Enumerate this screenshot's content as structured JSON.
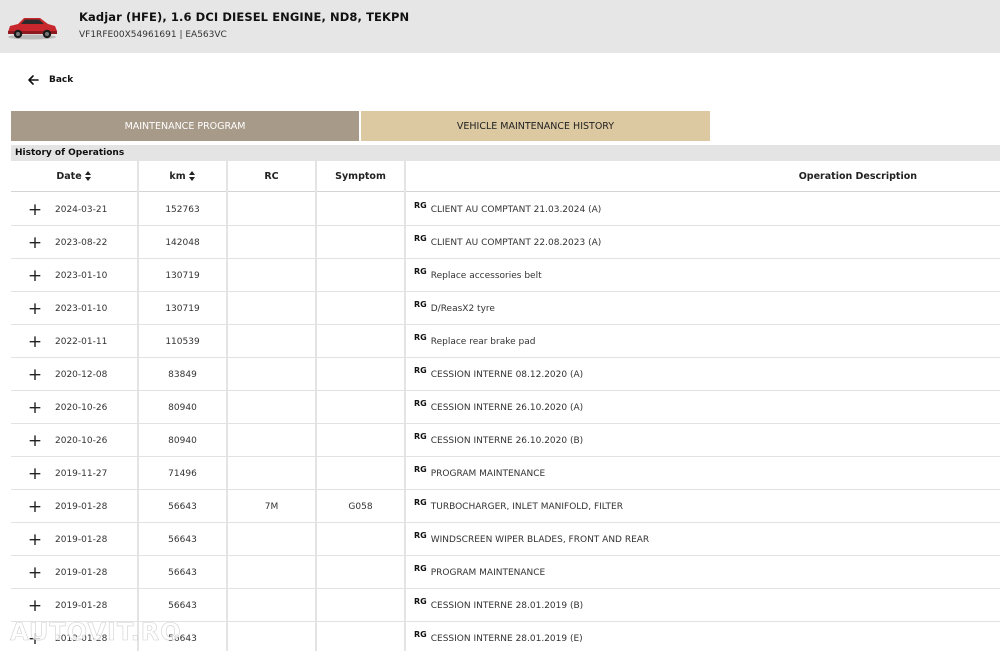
{
  "vehicle": {
    "title": "Kadjar (HFE), 1.6 DCI DIESEL ENGINE, ND8, TEKPN",
    "subtitle": "VF1RFE00X54961691 | EA563VC",
    "icon": "car-icon",
    "color": "#c8272d"
  },
  "nav": {
    "back_label": "Back"
  },
  "tabs": {
    "program": "MAINTENANCE PROGRAM",
    "history": "VEHICLE MAINTENANCE HISTORY",
    "program_color": "#a89a88",
    "history_color": "#dcc9a2"
  },
  "section": {
    "title": "History of Operations"
  },
  "table": {
    "headers": {
      "date": "Date",
      "km": "km",
      "rc": "RC",
      "symptom": "Symptom",
      "description": "Operation Description"
    },
    "tag": "RG",
    "rows": [
      {
        "date": "2024-03-21",
        "km": "152763",
        "rc": "",
        "symptom": "",
        "description": "CLIENT AU COMPTANT 21.03.2024 (A)"
      },
      {
        "date": "2023-08-22",
        "km": "142048",
        "rc": "",
        "symptom": "",
        "description": "CLIENT AU COMPTANT 22.08.2023 (A)"
      },
      {
        "date": "2023-01-10",
        "km": "130719",
        "rc": "",
        "symptom": "",
        "description": "Replace accessories belt"
      },
      {
        "date": "2023-01-10",
        "km": "130719",
        "rc": "",
        "symptom": "",
        "description": "D/ReasX2 tyre"
      },
      {
        "date": "2022-01-11",
        "km": "110539",
        "rc": "",
        "symptom": "",
        "description": "Replace rear brake pad"
      },
      {
        "date": "2020-12-08",
        "km": "83849",
        "rc": "",
        "symptom": "",
        "description": "CESSION INTERNE 08.12.2020 (A)"
      },
      {
        "date": "2020-10-26",
        "km": "80940",
        "rc": "",
        "symptom": "",
        "description": "CESSION INTERNE 26.10.2020 (A)"
      },
      {
        "date": "2020-10-26",
        "km": "80940",
        "rc": "",
        "symptom": "",
        "description": "CESSION INTERNE 26.10.2020 (B)"
      },
      {
        "date": "2019-11-27",
        "km": "71496",
        "rc": "",
        "symptom": "",
        "description": "PROGRAM MAINTENANCE"
      },
      {
        "date": "2019-01-28",
        "km": "56643",
        "rc": "7M",
        "symptom": "G058",
        "description": "TURBOCHARGER, INLET MANIFOLD, FILTER"
      },
      {
        "date": "2019-01-28",
        "km": "56643",
        "rc": "",
        "symptom": "",
        "description": "WINDSCREEN WIPER BLADES, FRONT AND REAR"
      },
      {
        "date": "2019-01-28",
        "km": "56643",
        "rc": "",
        "symptom": "",
        "description": "PROGRAM MAINTENANCE"
      },
      {
        "date": "2019-01-28",
        "km": "56643",
        "rc": "",
        "symptom": "",
        "description": "CESSION INTERNE 28.01.2019 (B)"
      },
      {
        "date": "2019-01-28",
        "km": "56643",
        "rc": "",
        "symptom": "",
        "description": "CESSION INTERNE 28.01.2019 (E)"
      }
    ]
  },
  "watermark": "AUTOVIT.RO"
}
